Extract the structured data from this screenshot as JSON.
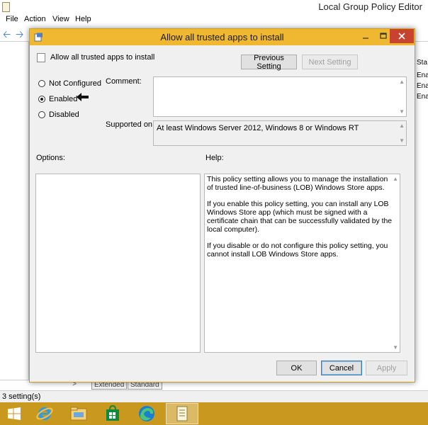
{
  "editor": {
    "title": "Local Group Policy Editor",
    "menu": [
      "File",
      "Action",
      "View",
      "Help"
    ],
    "right_pane_header": "Sta",
    "right_pane_values": [
      "Enal",
      "Enal",
      "Enal"
    ],
    "tabs": [
      "Extended",
      "Standard"
    ],
    "status": "3 setting(s)"
  },
  "dialog": {
    "title": "Allow all trusted apps to install",
    "policy_name": "Allow all trusted apps to install",
    "previous_setting": "Previous Setting",
    "next_setting": "Next Setting",
    "state_options": [
      "Not Configured",
      "Enabled",
      "Disabled"
    ],
    "selected_state": "Enabled",
    "comment_label": "Comment:",
    "comment_value": "",
    "supported_label": "Supported on:",
    "supported_value": "At least Windows Server 2012, Windows 8 or Windows RT",
    "options_label": "Options:",
    "help_label": "Help:",
    "help_paragraphs": [
      "This policy setting allows you to manage the installation of trusted line-of-business (LOB) Windows Store apps.",
      "If you enable this policy setting, you can install any LOB Windows Store app (which must be signed with a certificate chain that can be successfully validated by the local computer).",
      "If you disable or do not configure this policy setting, you cannot install LOB Windows Store apps."
    ],
    "ok": "OK",
    "cancel": "Cancel",
    "apply": "Apply"
  },
  "taskbar": {
    "items": [
      "start-icon",
      "internet-explorer-icon",
      "file-explorer-icon",
      "store-icon",
      "edge-icon",
      "policy-editor-icon"
    ],
    "color": "#c9991f"
  },
  "colors": {
    "dialog_title_bar": "#f0b831",
    "dialog_close": "#c7432f"
  }
}
